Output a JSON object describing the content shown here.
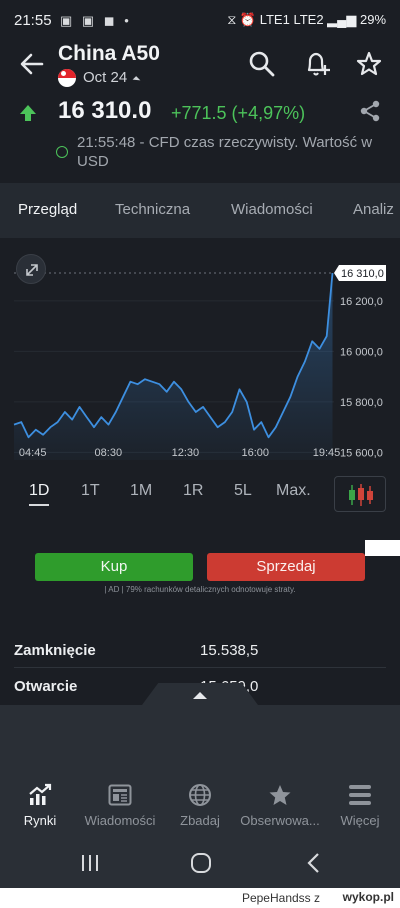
{
  "status_bar": {
    "time": "21:55",
    "left_icons": "▣ ▣ ◼ •",
    "right_icons": "⧖ ⏰ LTE1 LTE2 ▂▄▆ 29%"
  },
  "header": {
    "title": "China A50",
    "date": "Oct 24"
  },
  "quote": {
    "price": "16 310.0",
    "change": "+771.5 (+4,97%)",
    "info": "21:55:48 - CFD czas rzeczywisty. Wartość w USD"
  },
  "tabs": [
    "Przegląd",
    "Techniczna",
    "Wiadomości",
    "Analiz"
  ],
  "chart_data": {
    "type": "area",
    "x_ticks": [
      "04:45",
      "08:30",
      "12:30",
      "16:00",
      "19:45"
    ],
    "y_ticks": [
      "16 200,0",
      "16 000,0",
      "15 800,0",
      "15 600,0"
    ],
    "y_tick_values": [
      16200,
      16000,
      15800,
      15600
    ],
    "ylim": [
      15570,
      16330
    ],
    "last_value": 16310,
    "last_label": "16 310,0",
    "x_hours": [
      0.0,
      0.5,
      1.0,
      1.5,
      2.0,
      2.5,
      3.0,
      3.5,
      4.0,
      4.5,
      5.0,
      5.5,
      6.0,
      6.5,
      7.0,
      7.5,
      8.0,
      8.5,
      9.0,
      9.5,
      10.0,
      10.5,
      11.0,
      11.5,
      12.0,
      12.5,
      13.0,
      13.5,
      14.0,
      14.5,
      15.0,
      15.5,
      16.0,
      16.5,
      17.0,
      17.5,
      18.0,
      18.5,
      19.0,
      19.5,
      20.0,
      20.5,
      21.0,
      21.5,
      21.9
    ],
    "values": [
      15710,
      15720,
      15660,
      15690,
      15670,
      15700,
      15720,
      15760,
      15730,
      15780,
      15740,
      15700,
      15740,
      15710,
      15760,
      15820,
      15880,
      15870,
      15890,
      15880,
      15870,
      15840,
      15880,
      15850,
      15800,
      15760,
      15780,
      15740,
      15700,
      15720,
      15760,
      15850,
      15800,
      15690,
      15720,
      15660,
      15700,
      15760,
      15820,
      15900,
      15960,
      16040,
      16010,
      16060,
      16310
    ],
    "color": "#3d8fe0"
  },
  "ranges": {
    "items": [
      "1D",
      "1T",
      "1M",
      "1R",
      "5L",
      "Max."
    ],
    "active": "1D"
  },
  "trade": {
    "buy_label": "Kup",
    "sell_label": "Sprzedaj",
    "disclaimer": "| AD | 79% rachunków detalicznych odnotowuje straty."
  },
  "stats": [
    {
      "label": "Zamknięcie",
      "value": "15.538,5"
    },
    {
      "label": "Otwarcie",
      "value": "15.659,0"
    }
  ],
  "bottom_nav": [
    {
      "label": "Rynki",
      "icon": "chart-up-icon",
      "active": true
    },
    {
      "label": "Wiadomości",
      "icon": "newspaper-icon",
      "active": false
    },
    {
      "label": "Zbadaj",
      "icon": "globe-icon",
      "active": false
    },
    {
      "label": "Obserwowa...",
      "icon": "star-icon",
      "active": false
    },
    {
      "label": "Więcej",
      "icon": "menu-icon",
      "active": false
    }
  ],
  "footer": {
    "text": "PepeHandss z",
    "logo": "wykop.pl"
  },
  "colors": {
    "positive": "#4cc35a",
    "buy": "#2f9c2c",
    "sell": "#cc3b32",
    "chart_line": "#3d8fe0"
  }
}
